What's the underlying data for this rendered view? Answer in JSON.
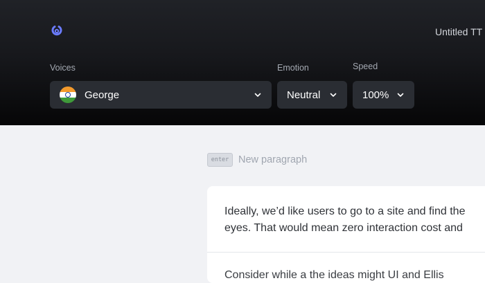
{
  "header": {
    "doc_title": "Untitled TT",
    "voices_label": "Voices",
    "emotion_label": "Emotion",
    "speed_label": "Speed",
    "voice": {
      "value": "George",
      "flag": "india-flag-icon"
    },
    "emotion": {
      "value": "Neutral"
    },
    "speed": {
      "value": "100%"
    }
  },
  "editor": {
    "hint_key": "enter",
    "hint_text": "New paragraph",
    "paragraph_1_line_1": "Ideally, we’d like users to go to a site and find the",
    "paragraph_1_line_2": "eyes. That would mean zero interaction cost and",
    "paragraph_2_partial": "Consider while a the ideas might UI and Ellis"
  },
  "colors": {
    "accent": "#6b7cff",
    "header_bg": "#17181c",
    "editor_bg": "#f1f2f5"
  }
}
